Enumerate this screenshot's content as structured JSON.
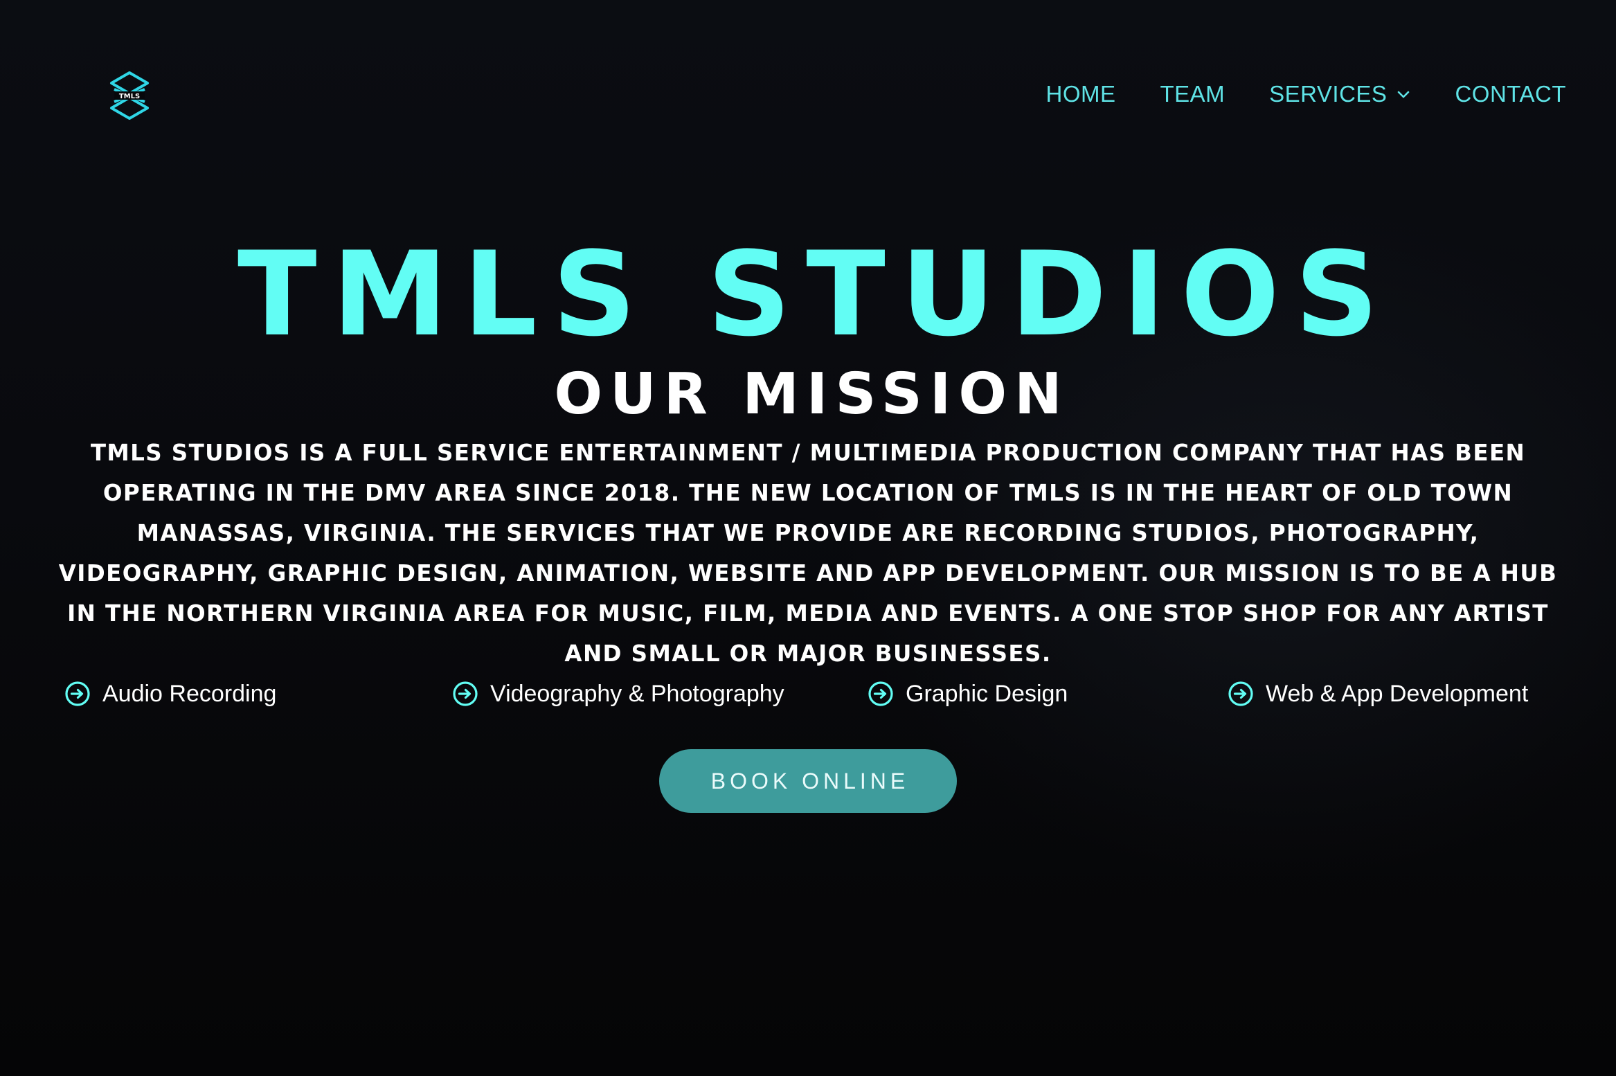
{
  "header": {
    "logo_text": "TMLS",
    "nav": [
      {
        "label": "HOME"
      },
      {
        "label": "TEAM"
      },
      {
        "label": "SERVICES",
        "has_dropdown": true,
        "icon": "chevron-down-icon"
      },
      {
        "label": "CONTACT"
      }
    ]
  },
  "hero": {
    "title": "TMLS STUDIOS",
    "subtitle": "OUR MISSION",
    "description": "TMLS STUDIOS IS A FULL SERVICE ENTERTAINMENT / MULTIMEDIA PRODUCTION COMPANY THAT HAS BEEN OPERATING IN THE DMV AREA SINCE 2018. THE NEW LOCATION OF TMLS IS IN THE HEART OF OLD TOWN MANASSAS, VIRGINIA. THE SERVICES THAT WE PROVIDE ARE RECORDING STUDIOS, PHOTOGRAPHY, VIDEOGRAPHY, GRAPHIC DESIGN, ANIMATION, WEBSITE AND APP DEVELOPMENT. OUR MISSION IS TO BE A HUB IN THE NORTHERN VIRGINIA AREA FOR MUSIC, FILM, MEDIA AND EVENTS. A ONE STOP SHOP FOR ANY ARTIST AND SMALL OR MAJOR BUSINESSES."
  },
  "services": [
    {
      "label": "Audio Recording",
      "icon": "arrow-circle-right-icon"
    },
    {
      "label": "Videography & Photography",
      "icon": "arrow-circle-right-icon"
    },
    {
      "label": "Graphic Design",
      "icon": "arrow-circle-right-icon"
    },
    {
      "label": "Web & App Development",
      "icon": "arrow-circle-right-icon"
    }
  ],
  "cta": {
    "label": "BOOK ONLINE"
  },
  "colors": {
    "accent": "#62fdf4",
    "nav_text": "#5fe3e6",
    "button_bg": "#3e9c9c",
    "background": "#07080b",
    "text": "#ffffff"
  }
}
